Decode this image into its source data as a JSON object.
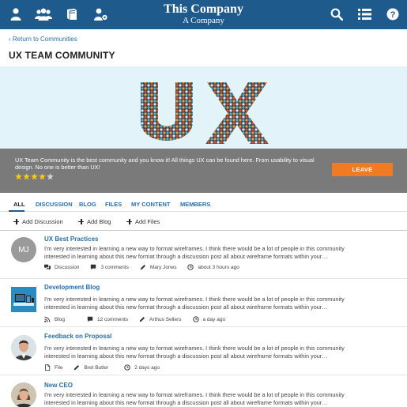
{
  "header": {
    "company": "This Company",
    "subtitle": "A Company",
    "icons_left": [
      "user-icon",
      "group-icon",
      "book-icon",
      "user-settings-icon"
    ],
    "icons_right": [
      "search-icon",
      "list-icon",
      "help-icon"
    ],
    "bg_color": "#1f5a8c"
  },
  "nav": {
    "return_label": "Return to Communities"
  },
  "page_title": "UX TEAM COMMUNITY",
  "banner": {
    "description": "UX Team Community is the best community and you know it! All things UX can be found here. From usability to visual design. No one is better than UX!",
    "rating": 4,
    "rating_max": 5,
    "leave_label": "LEAVE",
    "leave_color": "#f07b23"
  },
  "tabs": [
    {
      "label": "ALL",
      "active": true
    },
    {
      "label": "DISCUSSION"
    },
    {
      "label": "BLOG"
    },
    {
      "label": "FILES"
    },
    {
      "label": "MY CONTENT"
    },
    {
      "label": "MEMBERS"
    }
  ],
  "actions": [
    "Add Discussion",
    "Add Blog",
    "Add Files"
  ],
  "feed": [
    {
      "title": "UX Best Practices",
      "avatar_initials": "MJ",
      "body": "I'm very interested in learning a new way to format wireframes. I think there would be a lot of people in this community interested in learning about this new format through a discussion post all about wireframe formats within your…",
      "type": "Discussion",
      "comments": "3 comments",
      "author": "Mary Jones",
      "time": "about 3 hours ago"
    },
    {
      "title": "Development Blog",
      "body": "I'm very interested in learning a new way to format wireframes. I think there would be a lot of people in this community interested in learning about this new format through a discussion post all about wireframe formats within your…",
      "type": "Blog",
      "comments": "12 comments",
      "author": "Arthus Sellers",
      "time": "a day ago"
    },
    {
      "title": "Feedback on Proposal",
      "body": "I'm very interested in learning a new way to format wireframes. I think there would be a lot of people in this community interested in learning about this new format through a discussion post all about wireframe formats within your…",
      "type": "File",
      "author": "Bret Butler",
      "time": "2 days ago"
    },
    {
      "title": "New CEO",
      "body": "I'm very interested in learning a new way to format wireframes. I think there would be a lot of people in this community interested in learning about this new format through a discussion post all about wireframe formats within your…"
    }
  ]
}
